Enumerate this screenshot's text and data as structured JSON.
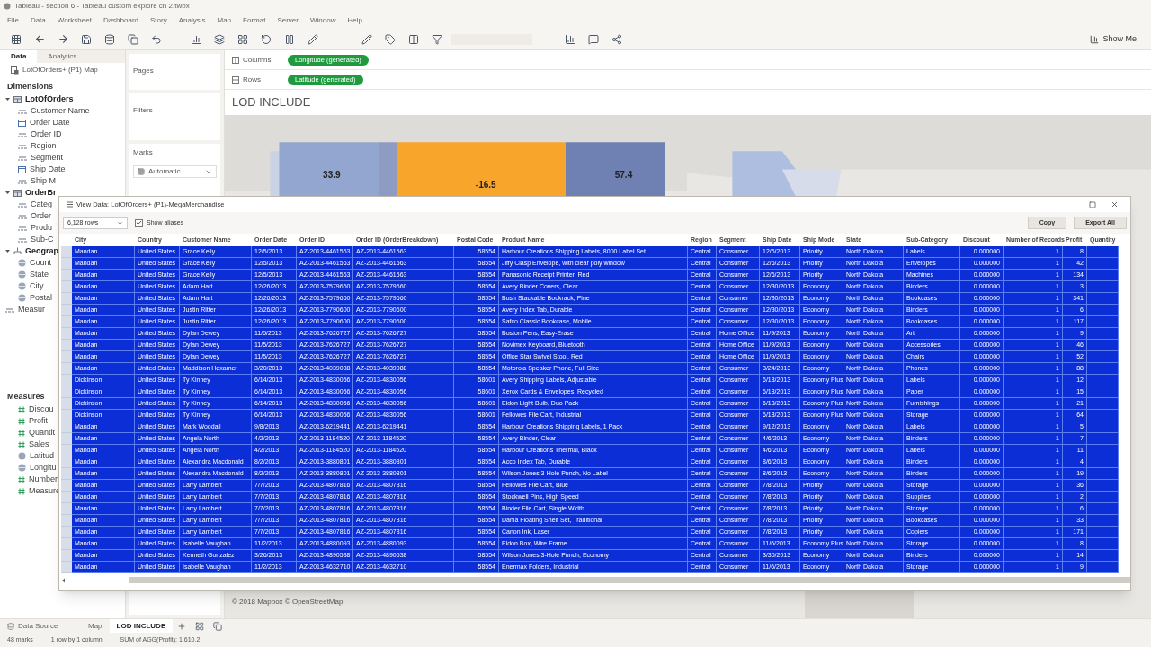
{
  "window": {
    "title": "Tableau - section 6 - Tableau custom explore ch 2.twbx"
  },
  "menu": [
    "File",
    "Data",
    "Worksheet",
    "Dashboard",
    "Story",
    "Analysis",
    "Map",
    "Format",
    "Server",
    "Window",
    "Help"
  ],
  "toolbar": {
    "show_me": "Show Me"
  },
  "data_pane": {
    "tabs": [
      {
        "label": "Data",
        "selected": true
      },
      {
        "label": "Analytics",
        "selected": false
      }
    ],
    "source": "LotOfOrders+ (P1) Map",
    "dimensions_title": "Dimensions",
    "dimension_tree": [
      {
        "label": "LotOfOrders",
        "kind": "folder",
        "expanded": true,
        "children": [
          {
            "label": "Customer Name",
            "kind": "text"
          },
          {
            "label": "Order Date",
            "kind": "date"
          },
          {
            "label": "Order ID",
            "kind": "text"
          },
          {
            "label": "Region",
            "kind": "text"
          },
          {
            "label": "Segment",
            "kind": "text"
          },
          {
            "label": "Ship Date",
            "kind": "date"
          },
          {
            "label": "Ship M",
            "kind": "text"
          }
        ]
      },
      {
        "label": "OrderBr",
        "kind": "folder",
        "expanded": true,
        "children": [
          {
            "label": "Categ",
            "kind": "text"
          },
          {
            "label": "Order",
            "kind": "text"
          },
          {
            "label": "Produ",
            "kind": "text"
          },
          {
            "label": "Sub-C",
            "kind": "text"
          }
        ]
      },
      {
        "label": "Geograp",
        "kind": "hierarchy",
        "expanded": true,
        "children": [
          {
            "label": "Count",
            "kind": "geo"
          },
          {
            "label": "State",
            "kind": "geo"
          },
          {
            "label": "City",
            "kind": "geo"
          },
          {
            "label": "Postal",
            "kind": "geo"
          }
        ]
      },
      {
        "label": "Measur",
        "kind": "text"
      }
    ],
    "measures_title": "Measures",
    "measures": [
      {
        "label": "Discou",
        "kind": "number"
      },
      {
        "label": "Profit",
        "kind": "number"
      },
      {
        "label": "Quantit",
        "kind": "number"
      },
      {
        "label": "Sales",
        "kind": "number"
      },
      {
        "label": "Latitud",
        "kind": "geo"
      },
      {
        "label": "Longitu",
        "kind": "geo"
      },
      {
        "label": "Number",
        "kind": "number"
      },
      {
        "label": "Measure",
        "kind": "number"
      }
    ]
  },
  "shelves": {
    "pages": "Pages",
    "filters": "Filters",
    "marks": "Marks",
    "mark_type": "Automatic"
  },
  "columns_shelf": {
    "label": "Columns",
    "pill": "Longitude (generated)"
  },
  "rows_shelf": {
    "label": "Rows",
    "pill": "Latitude (generated)"
  },
  "sheet_title": "LOD INCLUDE",
  "map": {
    "regions": [
      {
        "label": "33.9",
        "color": "#93a6cf"
      },
      {
        "label": "-16.5",
        "color": "#f7a52b"
      },
      {
        "label": "57.4",
        "color": "#6f80b2"
      }
    ],
    "attribution": "© 2018 Mapbox © OpenStreetMap"
  },
  "view_data": {
    "title": "View Data: LotOfOrders+ (P1)-MegaMerchandise",
    "rows_select": "6,128 rows",
    "show_aliases": {
      "label": "Show aliases",
      "checked": true
    },
    "buttons": [
      "Copy",
      "Export All"
    ],
    "columns": [
      "City",
      "Country",
      "Customer Name",
      "Order Date",
      "Order ID",
      "Order ID (OrderBreakdown)",
      "Postal Code",
      "Product Name",
      "Region",
      "Segment",
      "Ship Date",
      "Ship Mode",
      "State",
      "Sub-Category",
      "Discount",
      "Number of Records",
      "Profit",
      "Quantity"
    ],
    "rows": [
      {
        "selected": true,
        "cells": [
          "Mandan",
          "United States",
          "Grace Kelly",
          "12/5/2013",
          "AZ-2013-4461563",
          "AZ-2013-4461563",
          "58554",
          "Harbour Creations Shipping Labels, 8000 Label Set",
          "Central",
          "Consumer",
          "12/6/2013",
          "Priority",
          "North Dakota",
          "Labels",
          "0.000000",
          "1",
          "8"
        ]
      },
      {
        "selected": true,
        "cells": [
          "Mandan",
          "United States",
          "Grace Kelly",
          "12/5/2013",
          "AZ-2013-4461563",
          "AZ-2013-4461563",
          "58554",
          "Jiffy Clasp Envelope, with clear poly window",
          "Central",
          "Consumer",
          "12/6/2013",
          "Priority",
          "North Dakota",
          "Envelopes",
          "0.000000",
          "1",
          "42"
        ]
      },
      {
        "selected": true,
        "cells": [
          "Mandan",
          "United States",
          "Grace Kelly",
          "12/5/2013",
          "AZ-2013-4461563",
          "AZ-2013-4461563",
          "58554",
          "Panasonic Receipt Printer, Red",
          "Central",
          "Consumer",
          "12/6/2013",
          "Priority",
          "North Dakota",
          "Machines",
          "0.000000",
          "1",
          "134"
        ]
      },
      {
        "selected": true,
        "cells": [
          "Mandan",
          "United States",
          "Adam Hart",
          "12/26/2013",
          "AZ-2013-7579660",
          "AZ-2013-7579660",
          "58554",
          "Avery Binder Covers, Clear",
          "Central",
          "Consumer",
          "12/30/2013",
          "Economy",
          "North Dakota",
          "Binders",
          "0.000000",
          "1",
          "3"
        ]
      },
      {
        "selected": true,
        "cells": [
          "Mandan",
          "United States",
          "Adam Hart",
          "12/26/2013",
          "AZ-2013-7579660",
          "AZ-2013-7579660",
          "58554",
          "Bush Stackable Bookrack, Pine",
          "Central",
          "Consumer",
          "12/30/2013",
          "Economy",
          "North Dakota",
          "Bookcases",
          "0.000000",
          "1",
          "341"
        ]
      },
      {
        "selected": true,
        "cells": [
          "Mandan",
          "United States",
          "Justin Ritter",
          "12/26/2013",
          "AZ-2013-7790600",
          "AZ-2013-7790600",
          "58554",
          "Avery Index Tab, Durable",
          "Central",
          "Consumer",
          "12/30/2013",
          "Economy",
          "North Dakota",
          "Binders",
          "0.000000",
          "1",
          "6"
        ]
      },
      {
        "selected": true,
        "cells": [
          "Mandan",
          "United States",
          "Justin Ritter",
          "12/26/2013",
          "AZ-2013-7790600",
          "AZ-2013-7790600",
          "58554",
          "Safco Classic Bookcase, Mobile",
          "Central",
          "Consumer",
          "12/30/2013",
          "Economy",
          "North Dakota",
          "Bookcases",
          "0.000000",
          "1",
          "117"
        ]
      },
      {
        "selected": true,
        "cells": [
          "Mandan",
          "United States",
          "Dylan Dewey",
          "11/5/2013",
          "AZ-2013-7626727",
          "AZ-2013-7626727",
          "58554",
          "Boston Pens, Easy-Erase",
          "Central",
          "Home Office",
          "11/9/2013",
          "Economy",
          "North Dakota",
          "Art",
          "0.000000",
          "1",
          "9"
        ]
      },
      {
        "selected": true,
        "cells": [
          "Mandan",
          "United States",
          "Dylan Dewey",
          "11/5/2013",
          "AZ-2013-7626727",
          "AZ-2013-7626727",
          "58554",
          "Novimex Keyboard, Bluetooth",
          "Central",
          "Home Office",
          "11/9/2013",
          "Economy",
          "North Dakota",
          "Accessories",
          "0.000000",
          "1",
          "46"
        ]
      },
      {
        "selected": true,
        "cells": [
          "Mandan",
          "United States",
          "Dylan Dewey",
          "11/5/2013",
          "AZ-2013-7626727",
          "AZ-2013-7626727",
          "58554",
          "Office Star Swivel Stool, Red",
          "Central",
          "Home Office",
          "11/9/2013",
          "Economy",
          "North Dakota",
          "Chairs",
          "0.000000",
          "1",
          "52"
        ]
      },
      {
        "selected": true,
        "cells": [
          "Mandan",
          "United States",
          "Maddison Hexamer",
          "3/20/2013",
          "AZ-2013-4039088",
          "AZ-2013-4039088",
          "58554",
          "Motorola Speaker Phone, Full Size",
          "Central",
          "Consumer",
          "3/24/2013",
          "Economy",
          "North Dakota",
          "Phones",
          "0.000000",
          "1",
          "88"
        ]
      },
      {
        "selected": true,
        "cells": [
          "Dickinson",
          "United States",
          "Ty Kinney",
          "6/14/2013",
          "AZ-2013-4830056",
          "AZ-2013-4830056",
          "58601",
          "Avery Shipping Labels, Adjustable",
          "Central",
          "Consumer",
          "6/18/2013",
          "Economy Plus",
          "North Dakota",
          "Labels",
          "0.000000",
          "1",
          "12"
        ]
      },
      {
        "selected": true,
        "cells": [
          "Dickinson",
          "United States",
          "Ty Kinney",
          "6/14/2013",
          "AZ-2013-4830056",
          "AZ-2013-4830056",
          "58601",
          "Xerox Cards & Envelopes, Recycled",
          "Central",
          "Consumer",
          "6/18/2013",
          "Economy Plus",
          "North Dakota",
          "Paper",
          "0.000000",
          "1",
          "15"
        ]
      },
      {
        "selected": true,
        "cells": [
          "Dickinson",
          "United States",
          "Ty Kinney",
          "6/14/2013",
          "AZ-2013-4830056",
          "AZ-2013-4830056",
          "58601",
          "Eldon Light Bulb, Duo Pack",
          "Central",
          "Consumer",
          "6/18/2013",
          "Economy Plus",
          "North Dakota",
          "Furnishings",
          "0.000000",
          "1",
          "21"
        ]
      },
      {
        "selected": true,
        "cells": [
          "Dickinson",
          "United States",
          "Ty Kinney",
          "6/14/2013",
          "AZ-2013-4830056",
          "AZ-2013-4830056",
          "58601",
          "Fellowes File Cart, Industrial",
          "Central",
          "Consumer",
          "6/18/2013",
          "Economy Plus",
          "North Dakota",
          "Storage",
          "0.000000",
          "1",
          "64"
        ]
      },
      {
        "selected": true,
        "cells": [
          "Mandan",
          "United States",
          "Mark Woodall",
          "9/8/2013",
          "AZ-2013-6219441",
          "AZ-2013-6219441",
          "58554",
          "Harbour Creations Shipping Labels, 1 Pack",
          "Central",
          "Consumer",
          "9/12/2013",
          "Economy",
          "North Dakota",
          "Labels",
          "0.000000",
          "1",
          "5"
        ]
      },
      {
        "selected": true,
        "cells": [
          "Mandan",
          "United States",
          "Angela North",
          "4/2/2013",
          "AZ-2013-1184520",
          "AZ-2013-1184520",
          "58554",
          "Avery Binder, Clear",
          "Central",
          "Consumer",
          "4/6/2013",
          "Economy",
          "North Dakota",
          "Binders",
          "0.000000",
          "1",
          "7"
        ]
      },
      {
        "selected": true,
        "cells": [
          "Mandan",
          "United States",
          "Angela North",
          "4/2/2013",
          "AZ-2013-1184520",
          "AZ-2013-1184520",
          "58554",
          "Harbour Creations Thermal, Black",
          "Central",
          "Consumer",
          "4/6/2013",
          "Economy",
          "North Dakota",
          "Labels",
          "0.000000",
          "1",
          "11"
        ]
      },
      {
        "selected": true,
        "cells": [
          "Mandan",
          "United States",
          "Alexandra Macdonald",
          "8/2/2013",
          "AZ-2013-3880801",
          "AZ-2013-3880801",
          "58554",
          "Acco Index Tab, Durable",
          "Central",
          "Consumer",
          "8/6/2013",
          "Economy",
          "North Dakota",
          "Binders",
          "0.000000",
          "1",
          "4"
        ]
      },
      {
        "selected": true,
        "cells": [
          "Mandan",
          "United States",
          "Alexandra Macdonald",
          "8/2/2013",
          "AZ-2013-3880801",
          "AZ-2013-3880801",
          "58554",
          "Wilson Jones 3-Hole Punch, No Label",
          "Central",
          "Consumer",
          "8/6/2013",
          "Economy",
          "North Dakota",
          "Binders",
          "0.000000",
          "1",
          "19"
        ]
      },
      {
        "selected": true,
        "cells": [
          "Mandan",
          "United States",
          "Larry Lambert",
          "7/7/2013",
          "AZ-2013-4807816",
          "AZ-2013-4807816",
          "58554",
          "Fellowes File Cart, Blue",
          "Central",
          "Consumer",
          "7/8/2013",
          "Priority",
          "North Dakota",
          "Storage",
          "0.000000",
          "1",
          "36"
        ]
      },
      {
        "selected": true,
        "cells": [
          "Mandan",
          "United States",
          "Larry Lambert",
          "7/7/2013",
          "AZ-2013-4807816",
          "AZ-2013-4807816",
          "58554",
          "Stockwell Pins, High Speed",
          "Central",
          "Consumer",
          "7/8/2013",
          "Priority",
          "North Dakota",
          "Supplies",
          "0.000000",
          "1",
          "2"
        ]
      },
      {
        "selected": true,
        "cells": [
          "Mandan",
          "United States",
          "Larry Lambert",
          "7/7/2013",
          "AZ-2013-4807816",
          "AZ-2013-4807816",
          "58554",
          "Binder File Cart, Single Width",
          "Central",
          "Consumer",
          "7/8/2013",
          "Priority",
          "North Dakota",
          "Storage",
          "0.000000",
          "1",
          "6"
        ]
      },
      {
        "selected": true,
        "cells": [
          "Mandan",
          "United States",
          "Larry Lambert",
          "7/7/2013",
          "AZ-2013-4807816",
          "AZ-2013-4807816",
          "58554",
          "Dania Floating Shelf Set, Traditional",
          "Central",
          "Consumer",
          "7/8/2013",
          "Priority",
          "North Dakota",
          "Bookcases",
          "0.000000",
          "1",
          "33"
        ]
      },
      {
        "selected": true,
        "cells": [
          "Mandan",
          "United States",
          "Larry Lambert",
          "7/7/2013",
          "AZ-2013-4807816",
          "AZ-2013-4807816",
          "58554",
          "Canon Ink, Laser",
          "Central",
          "Consumer",
          "7/8/2013",
          "Priority",
          "North Dakota",
          "Copiers",
          "0.000000",
          "1",
          "171"
        ]
      },
      {
        "selected": true,
        "cells": [
          "Mandan",
          "United States",
          "Isabelle Vaughan",
          "11/2/2013",
          "AZ-2013-4880093",
          "AZ-2013-4880093",
          "58554",
          "Eldon Box, Wire Frame",
          "Central",
          "Consumer",
          "11/6/2013",
          "Economy Plus",
          "North Dakota",
          "Storage",
          "0.000000",
          "1",
          "8"
        ]
      },
      {
        "selected": true,
        "cells": [
          "Mandan",
          "United States",
          "Kenneth Gonzalez",
          "3/26/2013",
          "AZ-2013-4890538",
          "AZ-2013-4890538",
          "58554",
          "Wilson Jones 3-Hole Punch, Economy",
          "Central",
          "Consumer",
          "3/30/2013",
          "Economy",
          "North Dakota",
          "Binders",
          "0.000000",
          "1",
          "14"
        ]
      },
      {
        "selected": true,
        "cells": [
          "Mandan",
          "United States",
          "Isabelle Vaughan",
          "11/2/2013",
          "AZ-2013-4632710",
          "AZ-2013-4632710",
          "58554",
          "Enermax Folders, Industrial",
          "Central",
          "Consumer",
          "11/6/2013",
          "Economy",
          "North Dakota",
          "Storage",
          "0.000000",
          "1",
          "9"
        ]
      }
    ]
  },
  "sheet_tabs": [
    {
      "label": "Data Source",
      "kind": "source",
      "selected": false
    },
    {
      "label": "Map",
      "kind": "sheet",
      "selected": false
    },
    {
      "label": "LOD INCLUDE",
      "kind": "sheet",
      "selected": true
    }
  ],
  "status_bar": [
    "48 marks",
    "1 row by 1 column",
    "SUM of AGG(Profit): 1,610.2"
  ]
}
